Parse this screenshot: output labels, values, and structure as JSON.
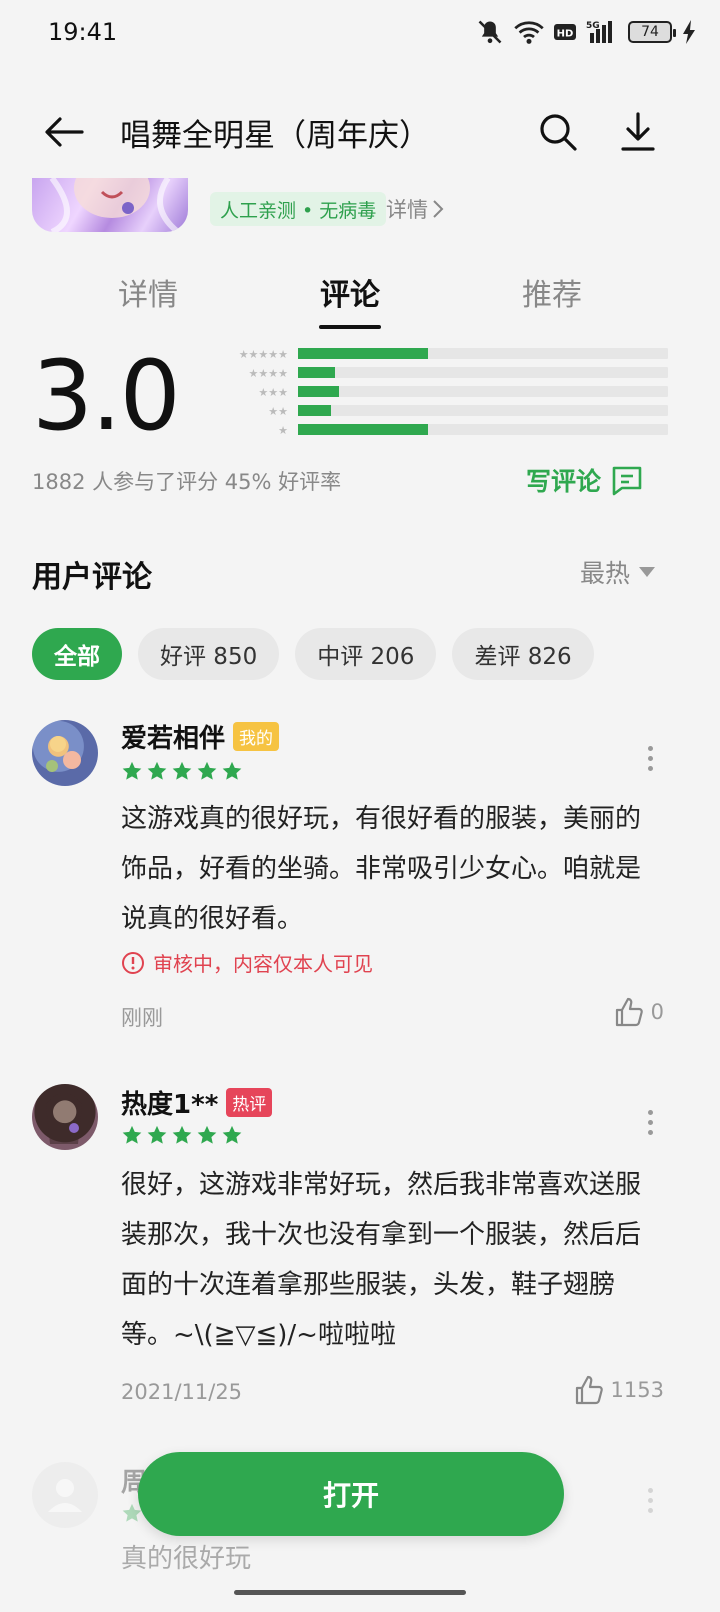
{
  "status_bar": {
    "time": "19:41",
    "battery": "74"
  },
  "header": {
    "title": "唱舞全明星（周年庆）"
  },
  "app_info": {
    "verified_tag": "人工亲测 • 无病毒",
    "detail_link": "详情"
  },
  "tabs": [
    {
      "label": "详情"
    },
    {
      "label": "评论"
    },
    {
      "label": "推荐"
    }
  ],
  "rating": {
    "score": "3.0",
    "summary": "1882 人参与了评分   45% 好评率",
    "write_review": "写评论",
    "distribution": [
      {
        "stars": 5,
        "fraction": 0.35
      },
      {
        "stars": 4,
        "fraction": 0.1
      },
      {
        "stars": 3,
        "fraction": 0.11
      },
      {
        "stars": 2,
        "fraction": 0.09
      },
      {
        "stars": 1,
        "fraction": 0.35
      }
    ]
  },
  "reviews_section": {
    "title": "用户评论",
    "sort": "最热",
    "filters": [
      {
        "label": "全部"
      },
      {
        "label": "好评 850"
      },
      {
        "label": "中评 206"
      },
      {
        "label": "差评 826"
      }
    ]
  },
  "reviews": [
    {
      "name": "爱若相伴",
      "badge": "我的",
      "stars": 5,
      "text": "这游戏真的很好玩，有很好看的服装，美丽的饰品，好看的坐骑。非常吸引少女心。咱就是说真的很好看。",
      "warning": "审核中，内容仅本人可见",
      "date": "刚刚",
      "likes": "0"
    },
    {
      "name": "热度1**",
      "badge": "热评",
      "stars": 5,
      "text": "很好，这游戏非常好玩，然后我非常喜欢送服装那次，我十次也没有拿到一个服装，然后后面的十次连着拿那些服装，头发，鞋子翅膀等。~\\(≧▽≦)/~啦啦啦",
      "date": "2021/11/25",
      "likes": "1153"
    },
    {
      "name": "周",
      "stars": 5,
      "text": "真的很好玩"
    }
  ],
  "open_button": "打开",
  "colors": {
    "accent": "#2fa84f",
    "warning": "#e04350",
    "badge_mine": "#f6c342",
    "badge_hot": "#e6455a"
  }
}
